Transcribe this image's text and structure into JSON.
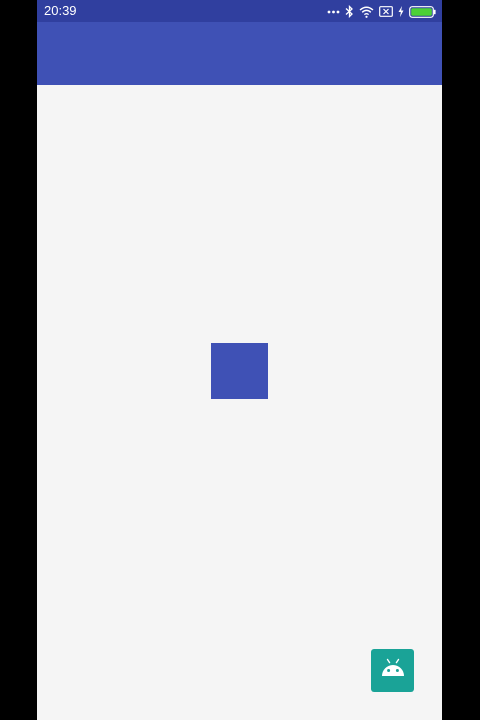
{
  "status_bar": {
    "time": "20:39",
    "icons": [
      "more-dots-icon",
      "bluetooth-icon",
      "wifi-icon",
      "sim-x-icon",
      "charging-icon",
      "battery-icon"
    ],
    "color": "#303f9f"
  },
  "app_bar": {
    "title": "",
    "color": "#3f51b5"
  },
  "content": {
    "background": "#f5f5f5",
    "square_color": "#3f51b5"
  },
  "fab": {
    "icon": "android-icon",
    "color": "#1aa397"
  }
}
